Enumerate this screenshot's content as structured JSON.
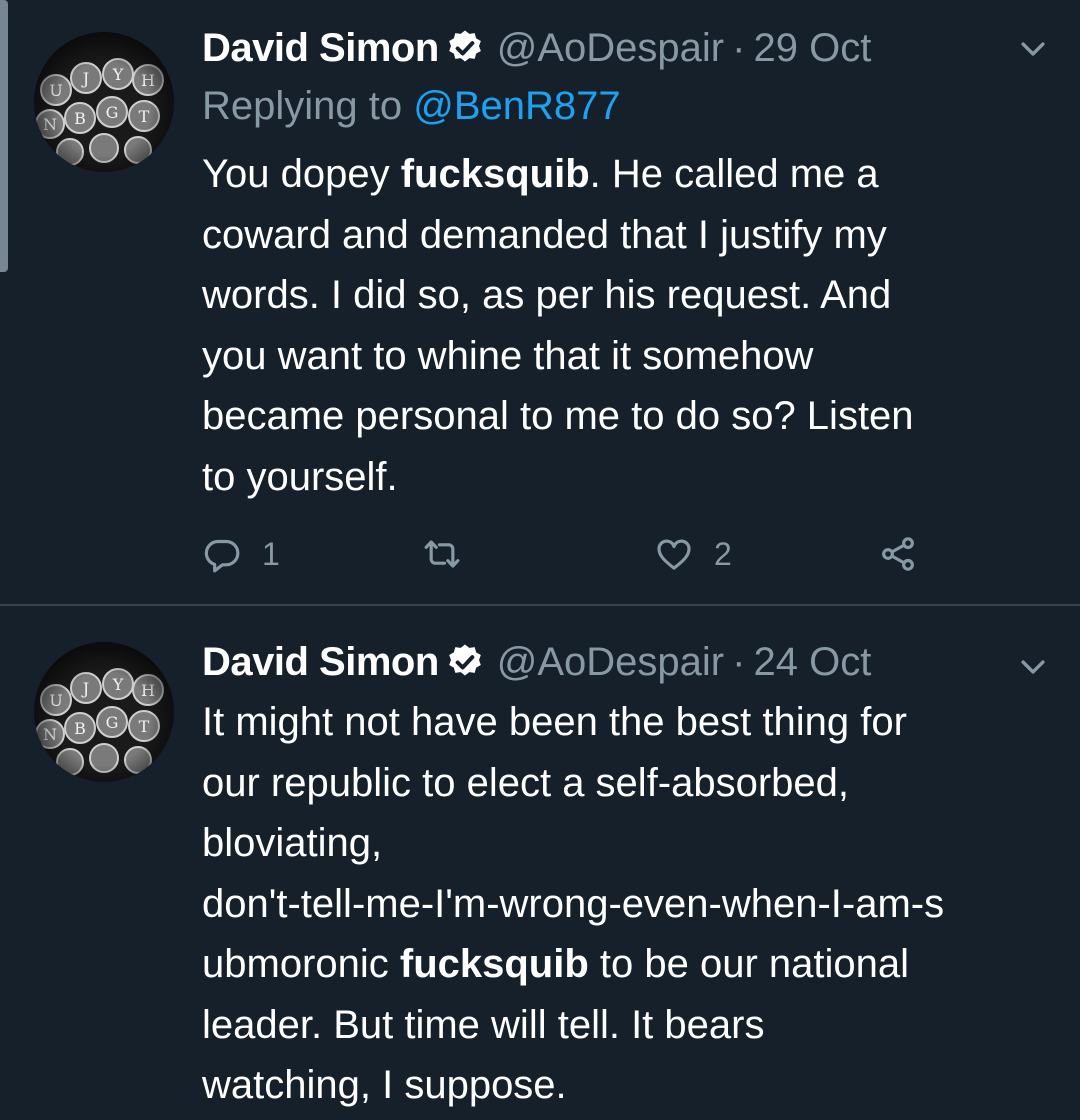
{
  "tweets": [
    {
      "author_name": "David Simon",
      "handle": "@AoDespair",
      "separator": "·",
      "date": "29 Oct",
      "replying_prefix": "Replying to",
      "replying_to": "@BenR877",
      "body_lines": [
        [
          "You dopey ",
          "fucksquib",
          ". He called me a"
        ],
        "coward and demanded that I justify my",
        "words. I did so, as per his request. And",
        "you want to whine that it somehow",
        "became personal to me to do so? Listen",
        "to yourself."
      ],
      "reply_count": "1",
      "like_count": "2"
    },
    {
      "author_name": "David Simon",
      "handle": "@AoDespair",
      "separator": "·",
      "date": "24 Oct",
      "body_lines": [
        "It might not have been the best thing for",
        "our republic to elect a self-absorbed,",
        "bloviating,",
        "don't-tell-me-I'm-wrong-even-when-I-am-s",
        [
          "ubmoronic ",
          "fucksquib",
          " to be our national"
        ],
        "leader. But time will tell. It bears",
        "watching, I suppose."
      ]
    }
  ],
  "icons": {
    "verified": "verified-badge-icon",
    "caret": "chevron-down-icon",
    "reply": "reply-icon",
    "retweet": "retweet-icon",
    "like": "heart-icon",
    "share": "share-icon"
  },
  "colors": {
    "background": "#15202b",
    "text": "#ffffff",
    "secondary": "#8899a6",
    "link": "#1da1f2",
    "divider": "#38444d"
  }
}
